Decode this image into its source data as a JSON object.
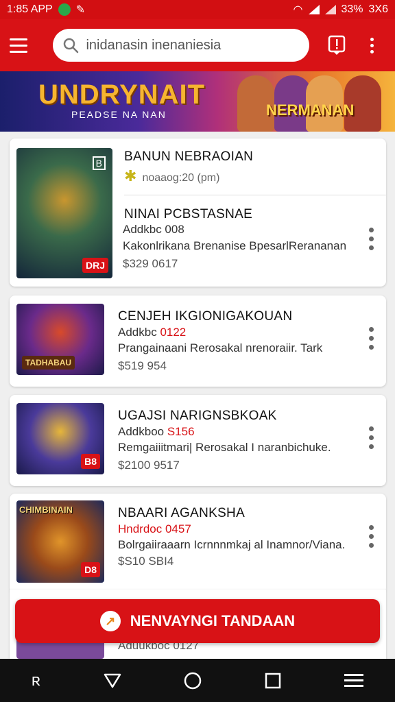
{
  "status": {
    "time": "1:85 APP",
    "battery": "33%",
    "extra": "3X6"
  },
  "search": {
    "value": "inidanasin inenaniesia"
  },
  "banner": {
    "title": "UNDRYNAIT",
    "subtitle": "PEADSE NA NAN",
    "right_title": "NERMANAN"
  },
  "cards": [
    {
      "header_title": "BANUN NEBRAOIAN",
      "header_sub": "noaaog:20 (pm)",
      "title": "NINAI PCBSTASNAE",
      "code": "Addkbc 008",
      "desc": "Kakonlrikana Brenanise BpesarlRerananan",
      "price": "$329 0617",
      "tag": "DRJ",
      "badge": "B"
    },
    {
      "title": "CENJEH IKGIONIGAKOUAN",
      "code_prefix": "Addkbc ",
      "code_red": "0122",
      "desc": "Prangainaani Rerosakal nrenoraiir. Tark",
      "price": "$519 954",
      "tag": "TADHABAU"
    },
    {
      "title": "UGAJSI NARIGNSBKOAK",
      "code_prefix": "Addkboo ",
      "code_red": "S156",
      "desc": "Remgaiiitmari| Rerosakal I naranbichuke.",
      "price": "$2100 9517",
      "tag": "B8"
    },
    {
      "title": "NBAARI AGANKSHA",
      "code_red": "Hndrdoc 0457",
      "desc": "Bolrgaiiraaarn Icrnnnmkaj al Inamnor/Viana.",
      "price": "$S10 SBI4",
      "tag": "D8",
      "thumb_title": "CHIMBINAIN"
    }
  ],
  "partial_card": {
    "code": "Aduukboc 0127"
  },
  "cta": {
    "label": "NENVAYNGI TANDAAN"
  }
}
